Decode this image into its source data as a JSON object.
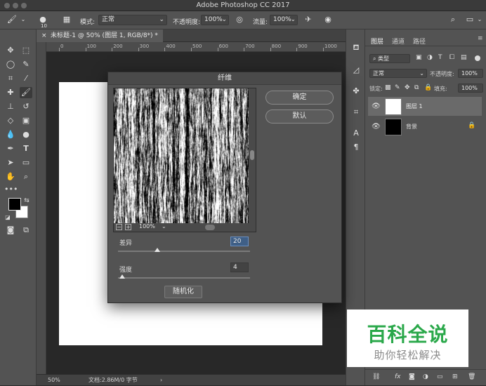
{
  "window": {
    "title": "Adobe Photoshop CC 2017"
  },
  "options_bar": {
    "brush_size": "10",
    "mode_label": "模式:",
    "mode_value": "正常",
    "opacity_label": "不透明度:",
    "opacity_value": "100%",
    "flow_label": "流量:",
    "flow_value": "100%"
  },
  "document": {
    "tab_label": "未标题-1 @ 50% (图层 1, RGB/8*) *",
    "ruler_ticks": [
      "0",
      "100",
      "200",
      "300",
      "400",
      "500",
      "600",
      "700",
      "800",
      "900",
      "1000"
    ],
    "status_zoom": "50%",
    "status_doc": "文档:2.86M/0 字节"
  },
  "dialog": {
    "title": "纤维",
    "ok_label": "确定",
    "default_label": "默认",
    "preview_zoom": "100%",
    "variance_label": "差异",
    "variance_value": "20",
    "variance_fraction": 0.3,
    "strength_label": "强度",
    "strength_value": "4",
    "strength_fraction": 0.03,
    "randomize_label": "随机化"
  },
  "layers_panel": {
    "tabs": [
      "图层",
      "通道",
      "路径"
    ],
    "filter_type": "类型",
    "blend_mode": "正常",
    "opacity_label": "不透明度:",
    "opacity_value": "100%",
    "lock_label": "锁定:",
    "fill_label": "填充:",
    "fill_value": "100%",
    "layers": [
      {
        "name": "图层 1",
        "thumb": "#ffffff"
      },
      {
        "name": "背景",
        "thumb": "#000000"
      }
    ]
  },
  "watermark": {
    "title": "百科全说",
    "subtitle": "助你轻松解决"
  },
  "colors": {
    "foreground": "#000000",
    "background": "#ffffff",
    "watermark_green": "#2aa84a"
  }
}
